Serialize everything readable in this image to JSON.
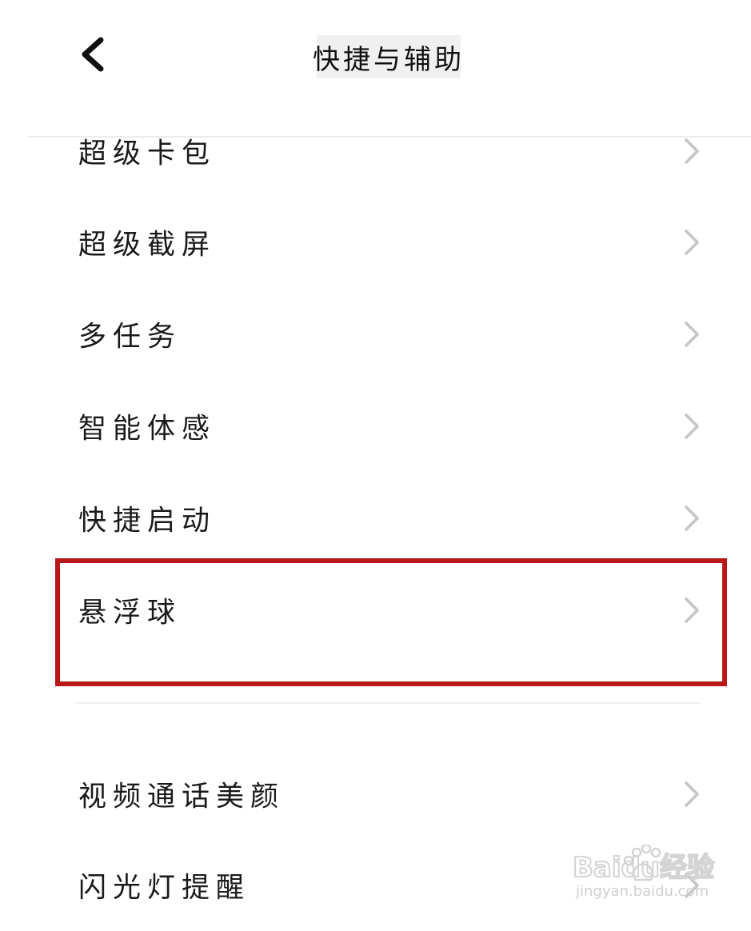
{
  "header": {
    "title": "快捷与辅助",
    "back_icon": "chevron-left-icon"
  },
  "items": [
    {
      "label": "超级卡包"
    },
    {
      "label": "超级截屏"
    },
    {
      "label": "多任务"
    },
    {
      "label": "智能体感"
    },
    {
      "label": "快捷启动"
    },
    {
      "label": "悬浮球"
    },
    {
      "label": "视频通话美颜"
    },
    {
      "label": "闪光灯提醒"
    }
  ],
  "highlight": {
    "target": "悬浮球",
    "color": "#b81818"
  },
  "watermark": {
    "brand": "Baidu经验",
    "url": "jingyan.baidu.com"
  },
  "colors": {
    "text": "#1a1a1a",
    "chevron": "#c4c4c4",
    "divider": "#ececec"
  }
}
